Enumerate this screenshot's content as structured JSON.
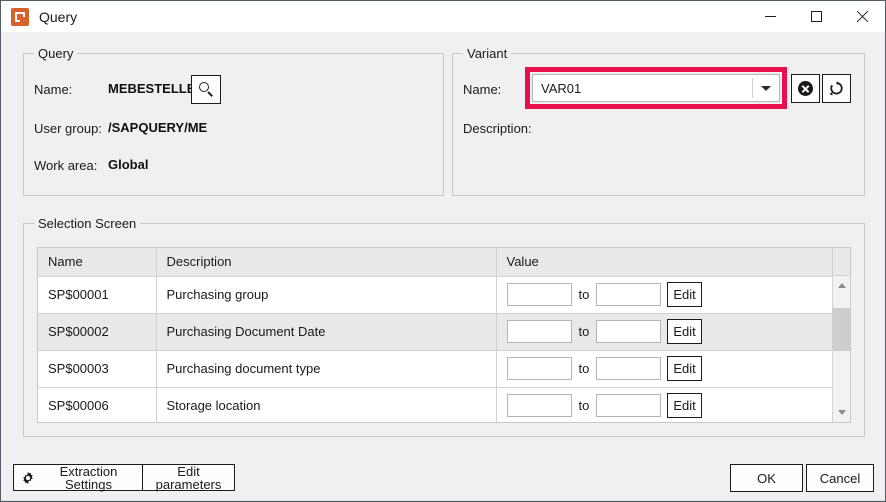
{
  "window": {
    "title": "Query",
    "app_icon": "app-logo-icon",
    "controls": {
      "minimize": "minimize-icon",
      "maximize": "maximize-icon",
      "close": "close-icon"
    }
  },
  "colors": {
    "highlight": "#E8114B",
    "app_icon": "#D8622B",
    "dialog_bg": "#F0F0F0",
    "header_row": "#E9E9E9",
    "alt_row": "#E9E9E9"
  },
  "query_group": {
    "legend": "Query",
    "name_label": "Name:",
    "name_value": "MEBESTELLB",
    "search_button_icon": "magnifier-icon",
    "user_group_label": "User group:",
    "user_group_value": "/SAPQUERY/ME",
    "work_area_label": "Work area:",
    "work_area_value": "Global"
  },
  "variant_group": {
    "legend": "Variant",
    "name_label": "Name:",
    "name_value": "VAR01",
    "name_placeholder": "",
    "dropdown_icon": "chevron-down-icon",
    "clear_button_icon": "cancel-circle-icon",
    "refresh_button_icon": "refresh-icon",
    "description_label": "Description:",
    "description_value": ""
  },
  "selection_screen": {
    "legend": "Selection Screen",
    "columns": [
      "Name",
      "Description",
      "Value"
    ],
    "rows": [
      {
        "name": "SP$00001",
        "description": "Purchasing group",
        "from_value": "",
        "to_label": "to",
        "to_value": "",
        "edit_label": "Edit"
      },
      {
        "name": "SP$00002",
        "description": "Purchasing Document Date",
        "from_value": "",
        "to_label": "to",
        "to_value": "",
        "edit_label": "Edit"
      },
      {
        "name": "SP$00003",
        "description": "Purchasing document type",
        "from_value": "",
        "to_label": "to",
        "to_value": "",
        "edit_label": "Edit"
      },
      {
        "name": "SP$00006",
        "description": "Storage location",
        "from_value": "",
        "to_label": "to",
        "to_value": "",
        "edit_label": "Edit"
      }
    ],
    "scrollbar": {
      "up_icon": "chevron-up-icon",
      "down_icon": "chevron-down-icon"
    }
  },
  "footer": {
    "extraction_settings_label": "Extraction Settings",
    "extraction_settings_icon": "gear-icon",
    "edit_parameters_label": "Edit parameters",
    "ok_label": "OK",
    "cancel_label": "Cancel"
  }
}
